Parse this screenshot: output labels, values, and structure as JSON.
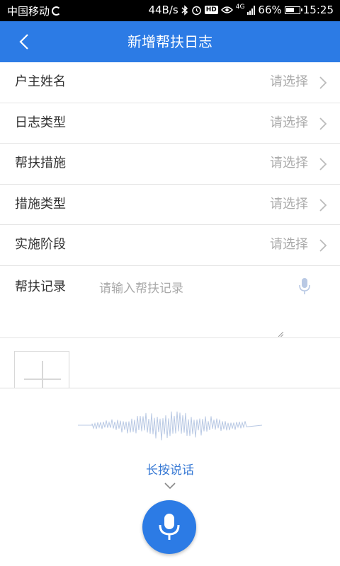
{
  "status_bar": {
    "carrier": "中国移动",
    "speed": "44B/s",
    "hd": "HD",
    "network": "4G",
    "battery": "66%",
    "battery_level": 0.66,
    "time": "15:25"
  },
  "header": {
    "title": "新增帮扶日志"
  },
  "form": {
    "rows": [
      {
        "label": "户主姓名",
        "value": "请选择"
      },
      {
        "label": "日志类型",
        "value": "请选择"
      },
      {
        "label": "帮扶措施",
        "value": "请选择"
      },
      {
        "label": "措施类型",
        "value": "请选择"
      },
      {
        "label": "实施阶段",
        "value": "请选择"
      }
    ],
    "record": {
      "label": "帮扶记录",
      "placeholder": "请输入帮扶记录"
    }
  },
  "voice": {
    "hold_text": "长按说话"
  },
  "colors": {
    "primary": "#2c7be5",
    "label": "#333333",
    "muted": "#aaaaaa"
  }
}
